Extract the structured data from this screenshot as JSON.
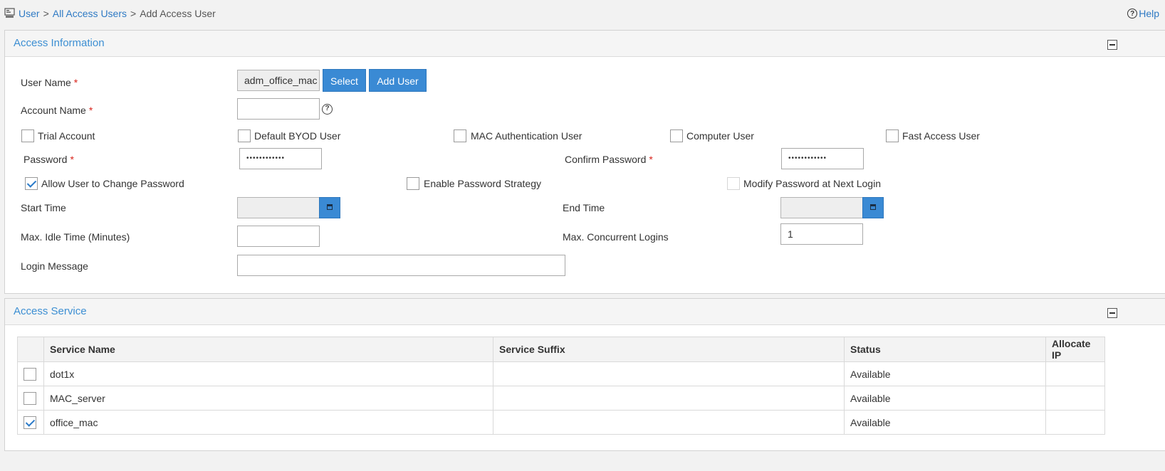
{
  "breadcrumb": {
    "items": [
      "User",
      "All Access Users",
      "Add Access User"
    ],
    "sep": ">"
  },
  "help": {
    "label": "Help"
  },
  "access_info": {
    "title": "Access Information",
    "user_name": {
      "label": "User Name",
      "required": "*",
      "value": "adm_office_mac",
      "select_label": "Select",
      "add_label": "Add User"
    },
    "account_name": {
      "label": "Account Name",
      "required": "*",
      "value": ""
    },
    "checks_row1": [
      {
        "label": "Trial Account",
        "checked": false
      },
      {
        "label": "Default BYOD User",
        "checked": false
      },
      {
        "label": "MAC Authentication User",
        "checked": false
      },
      {
        "label": "Computer User",
        "checked": false
      },
      {
        "label": "Fast Access User",
        "checked": false
      }
    ],
    "password": {
      "label": "Password",
      "required": "*",
      "value": "••••••••••••"
    },
    "confirm_password": {
      "label": "Confirm Password",
      "required": "*",
      "value": "••••••••••••"
    },
    "checks_row2": [
      {
        "label": "Allow User to Change Password",
        "checked": true
      },
      {
        "label": "Enable Password Strategy",
        "checked": false
      },
      {
        "label": "Modify Password at Next Login",
        "checked": false
      }
    ],
    "start_time": {
      "label": "Start Time",
      "value": ""
    },
    "end_time": {
      "label": "End Time",
      "value": ""
    },
    "max_idle": {
      "label": "Max. Idle Time (Minutes)",
      "value": ""
    },
    "max_concurrent": {
      "label": "Max. Concurrent Logins",
      "value": "1"
    },
    "login_message": {
      "label": "Login Message",
      "value": ""
    }
  },
  "access_service": {
    "title": "Access Service",
    "columns": [
      "Service Name",
      "Service Suffix",
      "Status",
      "Allocate IP"
    ],
    "rows": [
      {
        "checked": false,
        "name": "dot1x",
        "suffix": "",
        "status": "Available",
        "allocate_ip": ""
      },
      {
        "checked": false,
        "name": "MAC_server",
        "suffix": "",
        "status": "Available",
        "allocate_ip": ""
      },
      {
        "checked": true,
        "name": "office_mac",
        "suffix": "",
        "status": "Available",
        "allocate_ip": ""
      }
    ]
  },
  "colors": {
    "accent": "#3a8ad4",
    "link": "#2f7ac4",
    "title": "#3d8fd3",
    "required": "#d9251d"
  }
}
